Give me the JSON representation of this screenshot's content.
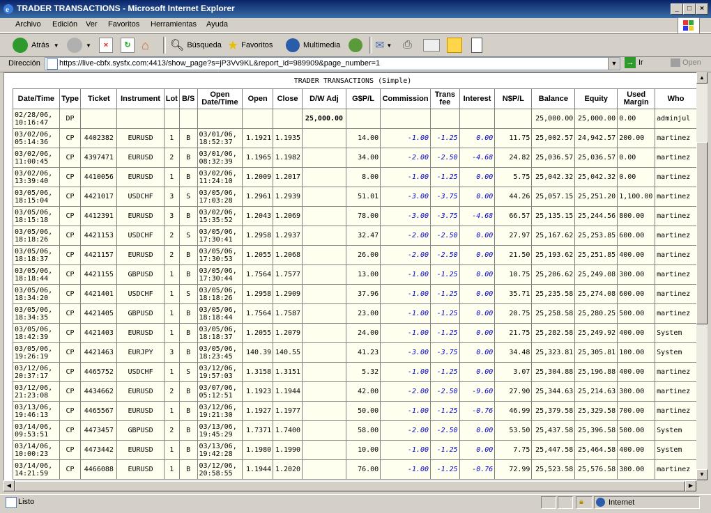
{
  "window": {
    "title": "TRADER TRANSACTIONS - Microsoft Internet Explorer"
  },
  "menu": [
    "Archivo",
    "Edición",
    "Ver",
    "Favoritos",
    "Herramientas",
    "Ayuda"
  ],
  "toolbar": {
    "back": "Atrás",
    "search": "Búsqueda",
    "favorites": "Favoritos",
    "multimedia": "Multimedia"
  },
  "address": {
    "label": "Dirección",
    "url": "https://live-cbfx.sysfx.com:4413/show_page?s=jP3Vv9KL&report_id=989909&page_number=1",
    "go": "Ir",
    "open": "Open"
  },
  "report": {
    "title": "TRADER TRANSACTIONS (Simple)",
    "headers": [
      "Date/Time",
      "Type",
      "Ticket",
      "Instrument",
      "Lot",
      "B/S",
      "Open Date/Time",
      "Open",
      "Close",
      "D/W Adj",
      "G$P/L",
      "Commission",
      "Trans fee",
      "Interest",
      "N$P/L",
      "Balance",
      "Equity",
      "Used Margin",
      "Who"
    ],
    "rows": [
      [
        "02/28/06, 10:16:47",
        "DP",
        "",
        "",
        "",
        "",
        "",
        "",
        "",
        "25,000.00",
        "",
        "",
        "",
        "",
        "",
        "25,000.00",
        "25,000.00",
        "0.00",
        "adminjul"
      ],
      [
        "03/02/06, 05:14:36",
        "CP",
        "4402382",
        "EURUSD",
        "1",
        "B",
        "03/01/06, 18:52:37",
        "1.1921",
        "1.1935",
        "",
        "14.00",
        "-1.00",
        "-1.25",
        "0.00",
        "11.75",
        "25,002.57",
        "24,942.57",
        "200.00",
        "martinez"
      ],
      [
        "03/02/06, 11:00:45",
        "CP",
        "4397471",
        "EURUSD",
        "2",
        "B",
        "03/01/06, 08:32:39",
        "1.1965",
        "1.1982",
        "",
        "34.00",
        "-2.00",
        "-2.50",
        "-4.68",
        "24.82",
        "25,036.57",
        "25,036.57",
        "0.00",
        "martinez"
      ],
      [
        "03/02/06, 13:39:40",
        "CP",
        "4410056",
        "EURUSD",
        "1",
        "B",
        "03/02/06, 11:24:10",
        "1.2009",
        "1.2017",
        "",
        "8.00",
        "-1.00",
        "-1.25",
        "0.00",
        "5.75",
        "25,042.32",
        "25,042.32",
        "0.00",
        "martinez"
      ],
      [
        "03/05/06, 18:15:04",
        "CP",
        "4421017",
        "USDCHF",
        "3",
        "S",
        "03/05/06, 17:03:28",
        "1.2961",
        "1.2939",
        "",
        "51.01",
        "-3.00",
        "-3.75",
        "0.00",
        "44.26",
        "25,057.15",
        "25,251.20",
        "1,100.00",
        "martinez"
      ],
      [
        "03/05/06, 18:15:18",
        "CP",
        "4412391",
        "EURUSD",
        "3",
        "B",
        "03/02/06, 15:35:52",
        "1.2043",
        "1.2069",
        "",
        "78.00",
        "-3.00",
        "-3.75",
        "-4.68",
        "66.57",
        "25,135.15",
        "25,244.56",
        "800.00",
        "martinez"
      ],
      [
        "03/05/06, 18:18:26",
        "CP",
        "4421153",
        "USDCHF",
        "2",
        "S",
        "03/05/06, 17:30:41",
        "1.2958",
        "1.2937",
        "",
        "32.47",
        "-2.00",
        "-2.50",
        "0.00",
        "27.97",
        "25,167.62",
        "25,253.85",
        "600.00",
        "martinez"
      ],
      [
        "03/05/06, 18:18:37",
        "CP",
        "4421157",
        "EURUSD",
        "2",
        "B",
        "03/05/06, 17:30:53",
        "1.2055",
        "1.2068",
        "",
        "26.00",
        "-2.00",
        "-2.50",
        "0.00",
        "21.50",
        "25,193.62",
        "25,251.85",
        "400.00",
        "martinez"
      ],
      [
        "03/05/06, 18:18:44",
        "CP",
        "4421155",
        "GBPUSD",
        "1",
        "B",
        "03/05/06, 17:30:44",
        "1.7564",
        "1.7577",
        "",
        "13.00",
        "-1.00",
        "-1.25",
        "0.00",
        "10.75",
        "25,206.62",
        "25,249.08",
        "300.00",
        "martinez"
      ],
      [
        "03/05/06, 18:34:20",
        "CP",
        "4421401",
        "USDCHF",
        "1",
        "S",
        "03/05/06, 18:18:26",
        "1.2958",
        "1.2909",
        "",
        "37.96",
        "-1.00",
        "-1.25",
        "0.00",
        "35.71",
        "25,235.58",
        "25,274.08",
        "600.00",
        "martinez"
      ],
      [
        "03/05/06, 18:34:35",
        "CP",
        "4421405",
        "GBPUSD",
        "1",
        "B",
        "03/05/06, 18:18:44",
        "1.7564",
        "1.7587",
        "",
        "23.00",
        "-1.00",
        "-1.25",
        "0.00",
        "20.75",
        "25,258.58",
        "25,280.25",
        "500.00",
        "martinez"
      ],
      [
        "03/05/06, 18:42:39",
        "CP",
        "4421403",
        "EURUSD",
        "1",
        "B",
        "03/05/06, 18:18:37",
        "1.2055",
        "1.2079",
        "",
        "24.00",
        "-1.00",
        "-1.25",
        "0.00",
        "21.75",
        "25,282.58",
        "25,249.92",
        "400.00",
        "System"
      ],
      [
        "03/05/06, 19:26:19",
        "CP",
        "4421463",
        "EURJPY",
        "3",
        "B",
        "03/05/06, 18:23:45",
        "140.39",
        "140.55",
        "",
        "41.23",
        "-3.00",
        "-3.75",
        "0.00",
        "34.48",
        "25,323.81",
        "25,305.81",
        "100.00",
        "System"
      ],
      [
        "03/12/06, 20:37:17",
        "CP",
        "4465752",
        "USDCHF",
        "1",
        "S",
        "03/12/06, 19:57:03",
        "1.3158",
        "1.3151",
        "",
        "5.32",
        "-1.00",
        "-1.25",
        "0.00",
        "3.07",
        "25,304.88",
        "25,196.88",
        "400.00",
        "martinez"
      ],
      [
        "03/12/06, 21:23:08",
        "CP",
        "4434662",
        "EURUSD",
        "2",
        "B",
        "03/07/06, 05:12:51",
        "1.1923",
        "1.1944",
        "",
        "42.00",
        "-2.00",
        "-2.50",
        "-9.60",
        "27.90",
        "25,344.63",
        "25,214.63",
        "300.00",
        "martinez"
      ],
      [
        "03/13/06, 19:46:13",
        "CP",
        "4465567",
        "EURUSD",
        "1",
        "B",
        "03/12/06, 19:21:30",
        "1.1927",
        "1.1977",
        "",
        "50.00",
        "-1.00",
        "-1.25",
        "-0.76",
        "46.99",
        "25,379.58",
        "25,329.58",
        "700.00",
        "martinez"
      ],
      [
        "03/14/06, 09:53:51",
        "CP",
        "4473457",
        "GBPUSD",
        "2",
        "B",
        "03/13/06, 19:45:29",
        "1.7371",
        "1.7400",
        "",
        "58.00",
        "-2.00",
        "-2.50",
        "0.00",
        "53.50",
        "25,437.58",
        "25,396.58",
        "500.00",
        "System"
      ],
      [
        "03/14/06, 10:00:23",
        "CP",
        "4473442",
        "EURUSD",
        "1",
        "B",
        "03/13/06, 19:42:28",
        "1.1980",
        "1.1990",
        "",
        "10.00",
        "-1.00",
        "-1.25",
        "0.00",
        "7.75",
        "25,447.58",
        "25,464.58",
        "400.00",
        "System"
      ],
      [
        "03/14/06, 14:21:59",
        "CP",
        "4466088",
        "EURUSD",
        "1",
        "B",
        "03/12/06, 20:58:55",
        "1.1944",
        "1.2020",
        "",
        "76.00",
        "-1.00",
        "-1.25",
        "-0.76",
        "72.99",
        "25,523.58",
        "25,576.58",
        "300.00",
        "martinez"
      ]
    ]
  },
  "status": {
    "text": "Listo",
    "zone": "Internet"
  },
  "colors": {
    "titlebar": "#0a246a",
    "blue_values": "#0000cc",
    "row_bg": "#fffff0"
  }
}
